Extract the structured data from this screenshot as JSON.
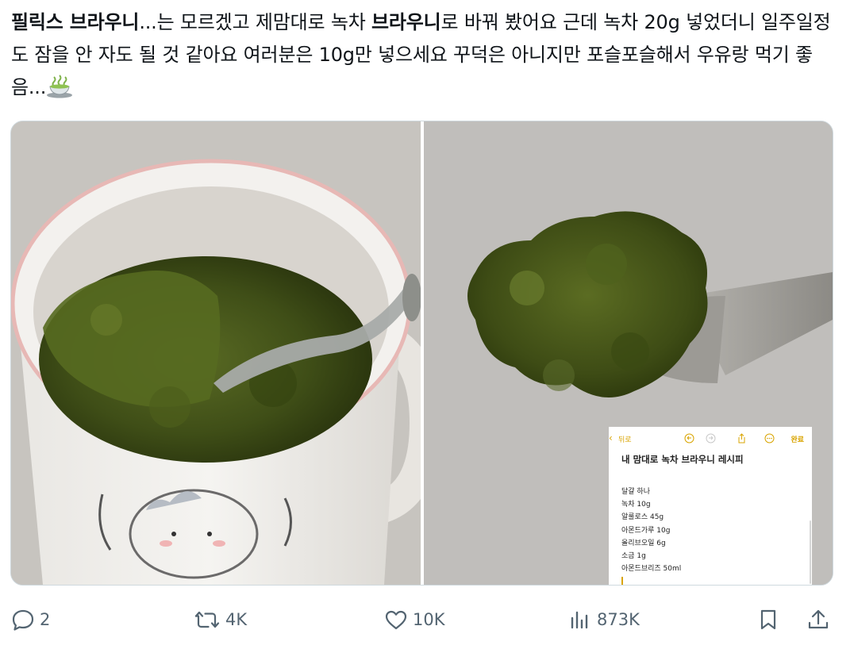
{
  "tweet": {
    "bold1": "필릭스 브라우니",
    "text1": "...는 모르겠고 제맘대로 녹차 ",
    "bold2": "브라우니",
    "text2": "로 바꿔 봤어요 근데 녹차 20g 넣었더니 일주일정도 잠을 안 자도 될 것 같아요 여러분은 10g만 넣으세요 꾸덕은 아니지만 포슬포슬해서 우유랑 먹기 좋음...",
    "emoji": "teacup-emoji"
  },
  "notes_overlay": {
    "back_label": "뒤로",
    "done_label": "완료",
    "title": "내 맘대로 녹차 브라우니 레시피",
    "lines": [
      "달걀 하나",
      "녹차 10g",
      "알룰로스 45g",
      "아몬드가루 10g",
      "올리브오일 6g",
      "소금 1g",
      "아몬드브리즈 50ml"
    ],
    "accent_color": "#d9a400"
  },
  "actions": {
    "reply_count": "2",
    "retweet_count": "4K",
    "like_count": "10K",
    "views_count": "873K",
    "icon_color": "#536471"
  }
}
